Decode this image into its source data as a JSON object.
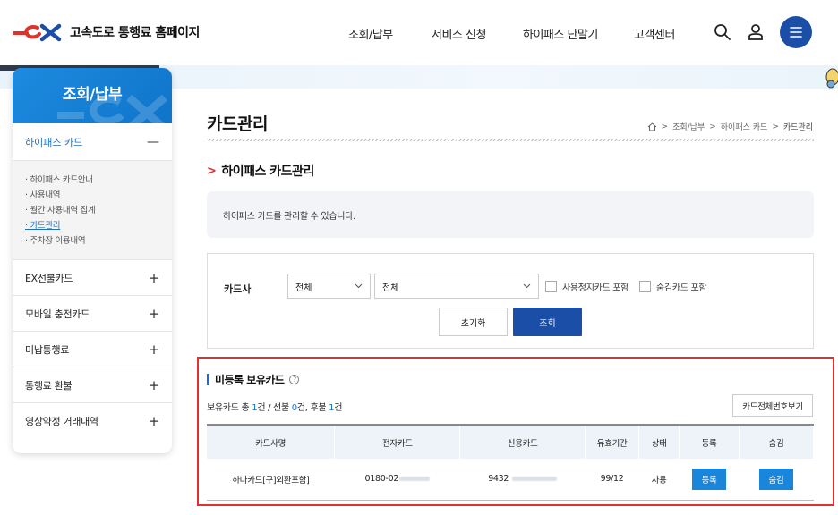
{
  "header": {
    "logo_text": "고속도로 통행료 홈페이지",
    "nav": [
      "조회/납부",
      "서비스 신청",
      "하이패스 단말기",
      "고객센터"
    ]
  },
  "sidebar": {
    "title": "조회/납부",
    "active_group": "하이패스 카드",
    "sub_items": [
      "하이패스 카드안내",
      "사용내역",
      "월간 사용내역 집계",
      "카드관리",
      "주차장 이용내역"
    ],
    "groups": [
      "EX선불카드",
      "모바일 충전카드",
      "미납통행료",
      "통행료 환불",
      "영상약정 거래내역"
    ]
  },
  "page": {
    "title": "카드관리",
    "breadcrumb": [
      "조회/납부",
      "하이패스 카드",
      "카드관리"
    ],
    "section_title": "하이패스 카드관리",
    "info_text": "하이패스 카드를 관리할 수 있습니다."
  },
  "search": {
    "label": "카드사",
    "select1": "전체",
    "select2": "전체",
    "check1": "사용정지카드 포함",
    "check2": "숨김카드 포함",
    "reset_label": "초기화",
    "search_label": "조회"
  },
  "unregistered": {
    "title": "미등록 보유카드",
    "summary_prefix": "보유카드 총 ",
    "total": "1",
    "summary_mid1": "건 / 선불 ",
    "prepaid": "0",
    "summary_mid2": "건, 후불 ",
    "postpaid": "1",
    "summary_suffix": "건",
    "show_all_label": "카드전체번호보기",
    "columns": [
      "카드사명",
      "전자카드",
      "신용카드",
      "유효기간",
      "상태",
      "등록",
      "숨김"
    ],
    "row": {
      "card_company": "하나카드[구]외환포함]",
      "e_card": "0180-02",
      "credit_card": "9432",
      "expiry": "99/12",
      "status": "사용",
      "register_label": "등록",
      "hide_label": "숨김"
    }
  }
}
